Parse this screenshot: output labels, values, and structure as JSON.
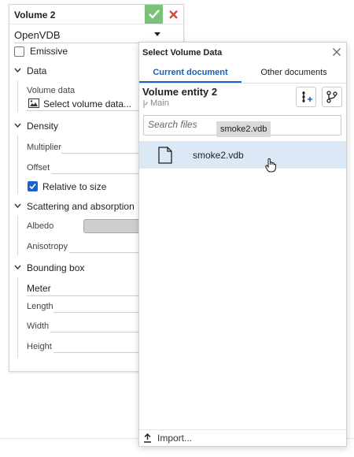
{
  "left_panel": {
    "title": "Volume 2",
    "type_select": "OpenVDB",
    "emissive_label": "Emissive",
    "emissive_checked": false,
    "sections": {
      "data": "Data",
      "density": "Density",
      "scattering": "Scattering and absorption",
      "bounding_box": "Bounding box"
    },
    "volume_data_label": "Volume data",
    "volume_data_value": "Select volume data...",
    "multiplier_label": "Multiplier",
    "offset_label": "Offset",
    "relative_label": "Relative to size",
    "relative_checked": true,
    "albedo_label": "Albedo",
    "albedo_color": "#cfcfcf",
    "anisotropy_label": "Anisotropy",
    "unit_value": "Meter",
    "length_label": "Length",
    "width_label": "Width",
    "height_label": "Height",
    "accent_ok": "#7ac27a",
    "accent_cancel": "#e0442a"
  },
  "dialog": {
    "title": "Select Volume Data",
    "tabs": [
      {
        "label": "Current document",
        "active": true
      },
      {
        "label": "Other documents",
        "active": false
      }
    ],
    "entity_title": "Volume entity 2",
    "branch": "Main",
    "search_placeholder": "Search files",
    "drag_tooltip": "smoke2.vdb",
    "files": [
      {
        "name": "smoke2.vdb",
        "selected": true
      }
    ],
    "import_label": "Import...",
    "accent": "#1a64c6",
    "selection_color": "#dbe9f6"
  }
}
